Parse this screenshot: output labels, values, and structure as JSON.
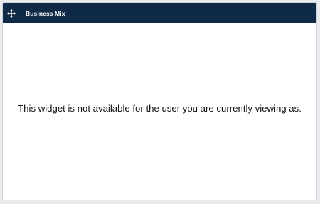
{
  "widget": {
    "title": "Business Mix",
    "drag_icon": "move-icon",
    "message": "This widget is not available for the user you are currently viewing as."
  },
  "colors": {
    "header_bg": "#0e2a47",
    "page_bg": "#e9ebee",
    "widget_bg": "#ffffff"
  }
}
